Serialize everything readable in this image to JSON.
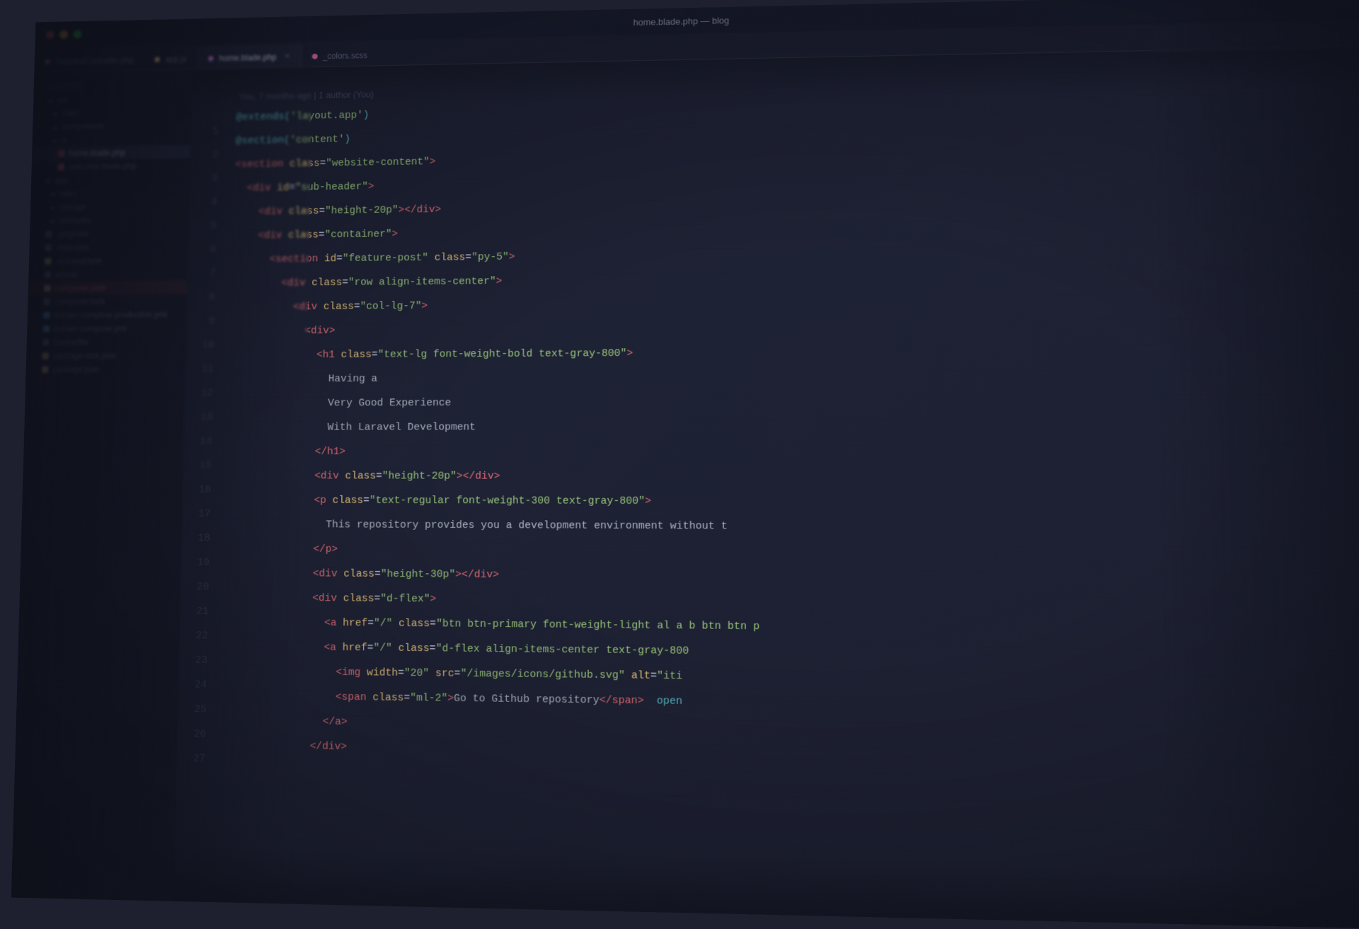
{
  "window": {
    "title": "home.blade.php — blog",
    "title_bar": "home.blade.php — blog"
  },
  "tabs": [
    {
      "id": "tab-req",
      "label": "RequestController.php",
      "dot_color": "pink",
      "active": false
    },
    {
      "id": "tab-app",
      "label": "app.js",
      "dot_color": "yellow",
      "active": false
    },
    {
      "id": "tab-home",
      "label": "home.blade.php",
      "dot_color": "magenta",
      "active": true,
      "closeable": true
    },
    {
      "id": "tab-colors",
      "label": "_colors.scss",
      "dot_color": "pink",
      "active": false
    }
  ],
  "sidebar": {
    "header": "CONTENT",
    "items": [
      {
        "name": "src",
        "type": "folder",
        "indent": 0
      },
      {
        "name": "rules",
        "type": "folder",
        "indent": 1
      },
      {
        "name": "components",
        "type": "folder",
        "indent": 1
      },
      {
        "name": "js",
        "type": "folder",
        "indent": 1
      },
      {
        "name": "home.blade.php",
        "type": "file",
        "color": "orange",
        "active": true
      },
      {
        "name": "welcome.blade.php",
        "type": "file",
        "color": "orange"
      },
      {
        "name": "app",
        "type": "folder",
        "indent": 0
      },
      {
        "name": "rules",
        "type": "folder",
        "indent": 1
      },
      {
        "name": "storage",
        "type": "folder",
        "indent": 1
      },
      {
        "name": "attributes",
        "type": "folder",
        "indent": 1
      },
      {
        "name": ".gitignore",
        "type": "file",
        "color": "text"
      },
      {
        "name": ".htaccess",
        "type": "file",
        "color": "text"
      },
      {
        "name": ".env.example",
        "type": "file",
        "color": "yellow"
      },
      {
        "name": "artisan",
        "type": "file",
        "color": "text"
      },
      {
        "name": "composer.json",
        "type": "file",
        "color": "yellow",
        "highlighted": true
      },
      {
        "name": "composer.lock",
        "type": "file",
        "color": "text"
      },
      {
        "name": "docker-compose.production.yml",
        "type": "file",
        "color": "blue"
      },
      {
        "name": "docker-compose.yml",
        "type": "file",
        "color": "blue"
      },
      {
        "name": "Dockerfile",
        "type": "file",
        "color": "text"
      },
      {
        "name": "package-lock.json",
        "type": "file",
        "color": "yellow"
      },
      {
        "name": "package.json",
        "type": "file",
        "color": "yellow"
      }
    ]
  },
  "editor": {
    "git_blame": "You, 7 months ago | 1 author (You)",
    "lines": [
      {
        "num": "",
        "content": []
      },
      {
        "num": "1",
        "tokens": [
          {
            "text": "@extends(",
            "class": "c-blade"
          },
          {
            "text": "'layout.app'",
            "class": "c-string"
          },
          {
            "text": ")",
            "class": "c-blade"
          }
        ]
      },
      {
        "num": "2",
        "tokens": [
          {
            "text": "@section(",
            "class": "c-blade"
          },
          {
            "text": "'content'",
            "class": "c-string"
          },
          {
            "text": ")",
            "class": "c-blade"
          }
        ]
      },
      {
        "num": "3",
        "tokens": [
          {
            "text": "<",
            "class": "c-tag"
          },
          {
            "text": "section",
            "class": "c-tag"
          },
          {
            "text": " class",
            "class": "c-attr"
          },
          {
            "text": "=",
            "class": "c-white"
          },
          {
            "text": "\"website-content\"",
            "class": "c-string"
          },
          {
            "text": ">",
            "class": "c-tag"
          }
        ]
      },
      {
        "num": "4",
        "tokens": [
          {
            "text": "  <",
            "class": "c-tag"
          },
          {
            "text": "div",
            "class": "c-tag"
          },
          {
            "text": " id",
            "class": "c-attr"
          },
          {
            "text": "=",
            "class": "c-white"
          },
          {
            "text": "\"sub-header\"",
            "class": "c-string"
          },
          {
            "text": ">",
            "class": "c-tag"
          }
        ]
      },
      {
        "num": "5",
        "tokens": [
          {
            "text": "    <",
            "class": "c-tag"
          },
          {
            "text": "div",
            "class": "c-tag"
          },
          {
            "text": " class",
            "class": "c-attr"
          },
          {
            "text": "=",
            "class": "c-white"
          },
          {
            "text": "\"height-20p\"",
            "class": "c-string"
          },
          {
            "text": "></",
            "class": "c-tag"
          },
          {
            "text": "div",
            "class": "c-tag"
          },
          {
            "text": ">",
            "class": "c-tag"
          }
        ]
      },
      {
        "num": "6",
        "tokens": [
          {
            "text": "    <",
            "class": "c-tag"
          },
          {
            "text": "div",
            "class": "c-tag"
          },
          {
            "text": " class",
            "class": "c-attr"
          },
          {
            "text": "=",
            "class": "c-white"
          },
          {
            "text": "\"container\"",
            "class": "c-string"
          },
          {
            "text": ">",
            "class": "c-tag"
          }
        ]
      },
      {
        "num": "7",
        "tokens": [
          {
            "text": "      <",
            "class": "c-tag"
          },
          {
            "text": "section",
            "class": "c-tag"
          },
          {
            "text": " id",
            "class": "c-attr"
          },
          {
            "text": "=",
            "class": "c-white"
          },
          {
            "text": "\"feature-post\"",
            "class": "c-string"
          },
          {
            "text": " class",
            "class": "c-attr"
          },
          {
            "text": "=",
            "class": "c-white"
          },
          {
            "text": "\"py-5\"",
            "class": "c-string"
          },
          {
            "text": ">",
            "class": "c-tag"
          }
        ]
      },
      {
        "num": "8",
        "tokens": [
          {
            "text": "        <",
            "class": "c-tag"
          },
          {
            "text": "div",
            "class": "c-tag"
          },
          {
            "text": " class",
            "class": "c-attr"
          },
          {
            "text": "=",
            "class": "c-white"
          },
          {
            "text": "\"row align-items-center\"",
            "class": "c-string"
          },
          {
            "text": ">",
            "class": "c-tag"
          }
        ]
      },
      {
        "num": "9",
        "tokens": [
          {
            "text": "          <",
            "class": "c-tag"
          },
          {
            "text": "div",
            "class": "c-tag"
          },
          {
            "text": " class",
            "class": "c-attr"
          },
          {
            "text": "=",
            "class": "c-white"
          },
          {
            "text": "\"col-lg-7\"",
            "class": "c-string"
          },
          {
            "text": ">",
            "class": "c-tag"
          }
        ]
      },
      {
        "num": "10",
        "tokens": [
          {
            "text": "            <",
            "class": "c-tag"
          },
          {
            "text": "div",
            "class": "c-tag"
          },
          {
            "text": ">",
            "class": "c-tag"
          }
        ]
      },
      {
        "num": "11",
        "tokens": [
          {
            "text": "              <",
            "class": "c-tag"
          },
          {
            "text": "h1",
            "class": "c-tag"
          },
          {
            "text": " class",
            "class": "c-attr"
          },
          {
            "text": "=",
            "class": "c-white"
          },
          {
            "text": "\"text-lg font-weight-bold text-gray-800\"",
            "class": "c-string"
          },
          {
            "text": ">",
            "class": "c-tag"
          }
        ]
      },
      {
        "num": "12",
        "tokens": [
          {
            "text": "                Having a",
            "class": "c-text"
          }
        ]
      },
      {
        "num": "13",
        "tokens": [
          {
            "text": "                Very Good Experience",
            "class": "c-text"
          }
        ]
      },
      {
        "num": "14",
        "tokens": [
          {
            "text": "                With Laravel Development",
            "class": "c-text"
          }
        ]
      },
      {
        "num": "15",
        "tokens": [
          {
            "text": "              </",
            "class": "c-tag"
          },
          {
            "text": "h1",
            "class": "c-tag"
          },
          {
            "text": ">",
            "class": "c-tag"
          }
        ]
      },
      {
        "num": "16",
        "tokens": [
          {
            "text": "              <",
            "class": "c-tag"
          },
          {
            "text": "div",
            "class": "c-tag"
          },
          {
            "text": " class",
            "class": "c-attr"
          },
          {
            "text": "=",
            "class": "c-white"
          },
          {
            "text": "\"height-20p\"",
            "class": "c-string"
          },
          {
            "text": "></",
            "class": "c-tag"
          },
          {
            "text": "div",
            "class": "c-tag"
          },
          {
            "text": ">",
            "class": "c-tag"
          }
        ]
      },
      {
        "num": "17",
        "tokens": [
          {
            "text": "              <",
            "class": "c-tag"
          },
          {
            "text": "p",
            "class": "c-tag"
          },
          {
            "text": " class",
            "class": "c-attr"
          },
          {
            "text": "=",
            "class": "c-white"
          },
          {
            "text": "\"text-regular font-weight-300 text-gray-800\"",
            "class": "c-string"
          },
          {
            "text": ">",
            "class": "c-tag"
          }
        ]
      },
      {
        "num": "18",
        "tokens": [
          {
            "text": "                This repository provides you a development environment without t",
            "class": "c-text"
          }
        ]
      },
      {
        "num": "19",
        "tokens": [
          {
            "text": "              </",
            "class": "c-tag"
          },
          {
            "text": "p",
            "class": "c-tag"
          },
          {
            "text": ">",
            "class": "c-tag"
          }
        ]
      },
      {
        "num": "20",
        "tokens": [
          {
            "text": "              <",
            "class": "c-tag"
          },
          {
            "text": "div",
            "class": "c-tag"
          },
          {
            "text": " class",
            "class": "c-attr"
          },
          {
            "text": "=",
            "class": "c-white"
          },
          {
            "text": "\"height-30p\"",
            "class": "c-string"
          },
          {
            "text": "></",
            "class": "c-tag"
          },
          {
            "text": "div",
            "class": "c-tag"
          },
          {
            "text": ">",
            "class": "c-tag"
          }
        ]
      },
      {
        "num": "21",
        "tokens": [
          {
            "text": "              <",
            "class": "c-tag"
          },
          {
            "text": "div",
            "class": "c-tag"
          },
          {
            "text": " class",
            "class": "c-attr"
          },
          {
            "text": "=",
            "class": "c-white"
          },
          {
            "text": "\"d-flex\"",
            "class": "c-string"
          },
          {
            "text": ">",
            "class": "c-tag"
          }
        ]
      },
      {
        "num": "22",
        "tokens": [
          {
            "text": "                <",
            "class": "c-tag"
          },
          {
            "text": "a",
            "class": "c-tag"
          },
          {
            "text": " href",
            "class": "c-attr"
          },
          {
            "text": "=",
            "class": "c-white"
          },
          {
            "text": "\"/\"",
            "class": "c-string"
          },
          {
            "text": " class",
            "class": "c-attr"
          },
          {
            "text": "=",
            "class": "c-white"
          },
          {
            "text": "\"btn btn-primary font-weight-light al a b btn btn p",
            "class": "c-string"
          }
        ]
      },
      {
        "num": "23",
        "tokens": [
          {
            "text": "                <",
            "class": "c-tag"
          },
          {
            "text": "a",
            "class": "c-tag"
          },
          {
            "text": " href",
            "class": "c-attr"
          },
          {
            "text": "=",
            "class": "c-white"
          },
          {
            "text": "\"/\"",
            "class": "c-string"
          },
          {
            "text": " class",
            "class": "c-attr"
          },
          {
            "text": "=",
            "class": "c-white"
          },
          {
            "text": "\"d-flex align-items-center text-gray-800",
            "class": "c-string"
          }
        ]
      },
      {
        "num": "24",
        "tokens": [
          {
            "text": "                  <",
            "class": "c-tag"
          },
          {
            "text": "img",
            "class": "c-tag"
          },
          {
            "text": " width",
            "class": "c-attr"
          },
          {
            "text": "=",
            "class": "c-white"
          },
          {
            "text": "\"20\"",
            "class": "c-string"
          },
          {
            "text": " src",
            "class": "c-attr"
          },
          {
            "text": "=",
            "class": "c-white"
          },
          {
            "text": "\"/images/icons/github.svg\"",
            "class": "c-string"
          },
          {
            "text": " alt",
            "class": "c-attr"
          },
          {
            "text": "=",
            "class": "c-white"
          },
          {
            "text": "\"iti",
            "class": "c-string"
          }
        ]
      },
      {
        "num": "25",
        "tokens": [
          {
            "text": "                  <",
            "class": "c-tag"
          },
          {
            "text": "span",
            "class": "c-tag"
          },
          {
            "text": " class",
            "class": "c-attr"
          },
          {
            "text": "=",
            "class": "c-white"
          },
          {
            "text": "\"ml-2\"",
            "class": "c-string"
          },
          {
            "text": ">Go to Github repository</",
            "class": "c-text"
          },
          {
            "text": "span",
            "class": "c-tag"
          },
          {
            "text": ">  open",
            "class": "c-cyan"
          }
        ]
      },
      {
        "num": "26",
        "tokens": [
          {
            "text": "                </",
            "class": "c-tag"
          },
          {
            "text": "a",
            "class": "c-tag"
          },
          {
            "text": ">",
            "class": "c-tag"
          }
        ]
      },
      {
        "num": "27",
        "tokens": [
          {
            "text": "              </",
            "class": "c-tag"
          },
          {
            "text": "div",
            "class": "c-tag"
          },
          {
            "text": ">",
            "class": "c-tag"
          }
        ]
      }
    ]
  }
}
